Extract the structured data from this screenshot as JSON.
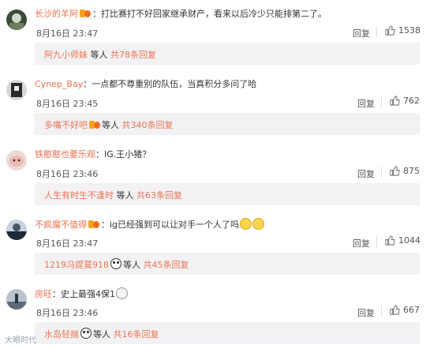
{
  "comments": [
    {
      "username": "长沙的羊阿",
      "text": "打比赛打不好回家继承财产，看来以后冷少只能排第二了。",
      "date": "8月16日 23:47",
      "reply_label": "回复",
      "likes": "1538",
      "sub": {
        "name": "阿九小师妹",
        "mid": "等人",
        "tail": "共78条回复"
      }
    },
    {
      "username": "Cynep_Bay",
      "text": "一点都不尊重别的队伍，当真积分多问了哈",
      "date": "8月16日 23:45",
      "reply_label": "回复",
      "likes": "762",
      "sub": {
        "name": "多嘴不好吧",
        "mid": "等人",
        "tail": "共340条回复"
      }
    },
    {
      "username": "铁憨憨也要乐观",
      "text": "IG.王小猪？",
      "date": "8月16日 23:46",
      "reply_label": "回复",
      "likes": "875",
      "sub": {
        "name": "人生有时生不逢时",
        "mid": "等人",
        "tail": "共63条回复"
      }
    },
    {
      "username": "不疯魔不值得",
      "text": "ig已经强到可以让对手一个人了吗",
      "date": "8月16日 23:47",
      "reply_label": "回复",
      "likes": "1044",
      "sub": {
        "name": "1219冯提莫918",
        "mid": "等人",
        "tail": "共45条回复"
      }
    },
    {
      "username": "房旺",
      "text": "史上最强4保1",
      "date": "8月16日 23:46",
      "reply_label": "回复",
      "likes": "667",
      "sub": {
        "name": "水岛轻揣",
        "mid": "等人",
        "tail": "共16条回复"
      }
    }
  ],
  "watermark": "大眼时代",
  "colors": {
    "accent": "#eb7350",
    "subbox": "#f2f2f5"
  },
  "icons": {
    "like": "thumbs-up-icon",
    "vip": "vip-badge-icon"
  }
}
